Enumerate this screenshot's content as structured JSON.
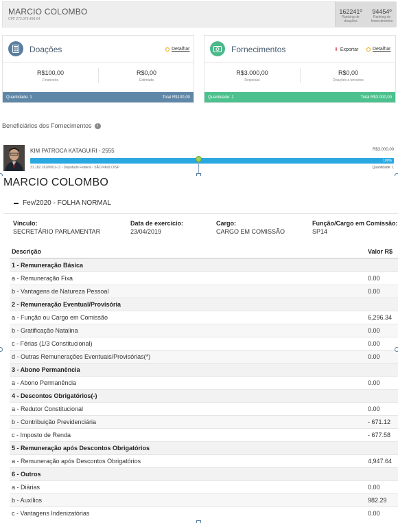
{
  "header": {
    "name": "MARCIO COLOMBO",
    "cpf": "CPF 272.079.468-64",
    "rankings": [
      {
        "value": "162241º",
        "label_line1": "Ranking de",
        "label_line2": "doações"
      },
      {
        "value": "94454º",
        "label_line1": "Ranking de",
        "label_line2": "fornecimentos"
      }
    ]
  },
  "doacoes": {
    "title": "Doações",
    "detail_label": "Detalhar",
    "values": [
      {
        "amount": "R$100,00",
        "label": "Financeira"
      },
      {
        "amount": "R$0,00",
        "label": "Estimada"
      }
    ],
    "footer_qty": "Quantidade: 1",
    "footer_total": "Total R$100,00",
    "colors": {
      "icon": "#5a7ea0",
      "footer": "#5f87a8"
    }
  },
  "fornecimentos": {
    "title": "Fornecimentos",
    "export_label": "Exportar",
    "detail_label": "Detalhar",
    "values": [
      {
        "amount": "R$3.000,00",
        "label": "Despesas"
      },
      {
        "amount": "R$0,00",
        "label": "Doações a terceiros"
      }
    ],
    "footer_qty": "Quantidade: 1",
    "footer_total": "Total R$3.000,00",
    "colors": {
      "icon": "#4cb98a",
      "footer": "#4cc18e"
    }
  },
  "beneficiarios": {
    "title": "Beneficiários dos Fornecimentos",
    "count": "1",
    "item": {
      "name": "KIM PATROCA KATAGUIRI - 2555",
      "value": "R$3.000,00",
      "percent_text": "100%",
      "percent": 100,
      "info": "31.182.162/0001-11 - Deputado Federal - SÃO PAULO/SP",
      "qty": "Quantidade: 1"
    }
  },
  "remuneracao": {
    "title": "MARCIO COLOMBO",
    "period": "Fev/2020 - FOLHA NORMAL",
    "fields": [
      {
        "label": "Vínculo:",
        "value": "SECRETÁRIO PARLAMENTAR"
      },
      {
        "label": "Data de exercício:",
        "value": "23/04/2019"
      },
      {
        "label": "Cargo:",
        "value": "CARGO EM COMISSÃO"
      },
      {
        "label": "Função/Cargo em Comissão:",
        "value": "SP14"
      }
    ],
    "table_headers": {
      "desc": "Descrição",
      "value": "Valor R$"
    },
    "rows": [
      {
        "section": true,
        "desc": "1 - Remuneração Básica",
        "value": ""
      },
      {
        "desc": "a - Remuneração Fixa",
        "value": "0.00"
      },
      {
        "desc": "b - Vantagens de Natureza Pessoal",
        "value": "0.00"
      },
      {
        "section": true,
        "desc": "2 - Remuneração Eventual/Provisória",
        "value": ""
      },
      {
        "desc": "a - Função ou Cargo em Comissão",
        "value": "6,296.34"
      },
      {
        "desc": "b - Gratificação Natalina",
        "value": "0.00"
      },
      {
        "desc": "c - Férias (1/3 Constitucional)",
        "value": "0.00"
      },
      {
        "desc": "d - Outras Remunerações Eventuais/Provisórias(*)",
        "value": "0.00"
      },
      {
        "section": true,
        "desc": "3 - Abono Permanência",
        "value": ""
      },
      {
        "desc": "a - Abono Permanência",
        "value": "0.00"
      },
      {
        "section": true,
        "desc": "4 - Descontos Obrigatórios(-)",
        "value": ""
      },
      {
        "desc": "a - Redutor Constitucional",
        "value": "0.00"
      },
      {
        "desc": "b - Contribuição Previdenciária",
        "value": "- 671.12"
      },
      {
        "desc": "c - Imposto de Renda",
        "value": "- 677.58"
      },
      {
        "section": true,
        "desc": "5 - Remuneração após Descontos Obrigatórios",
        "value": ""
      },
      {
        "desc": "a - Remuneração após Descontos Obrigatórios",
        "value": "4,947.64"
      },
      {
        "section": true,
        "desc": "6 - Outros",
        "value": ""
      },
      {
        "desc": "a - Diárias",
        "value": "0.00"
      },
      {
        "desc": "b - Auxílios",
        "value": "982.29"
      },
      {
        "desc": "c - Vantagens Indenizatórias",
        "value": "0.00"
      }
    ]
  }
}
